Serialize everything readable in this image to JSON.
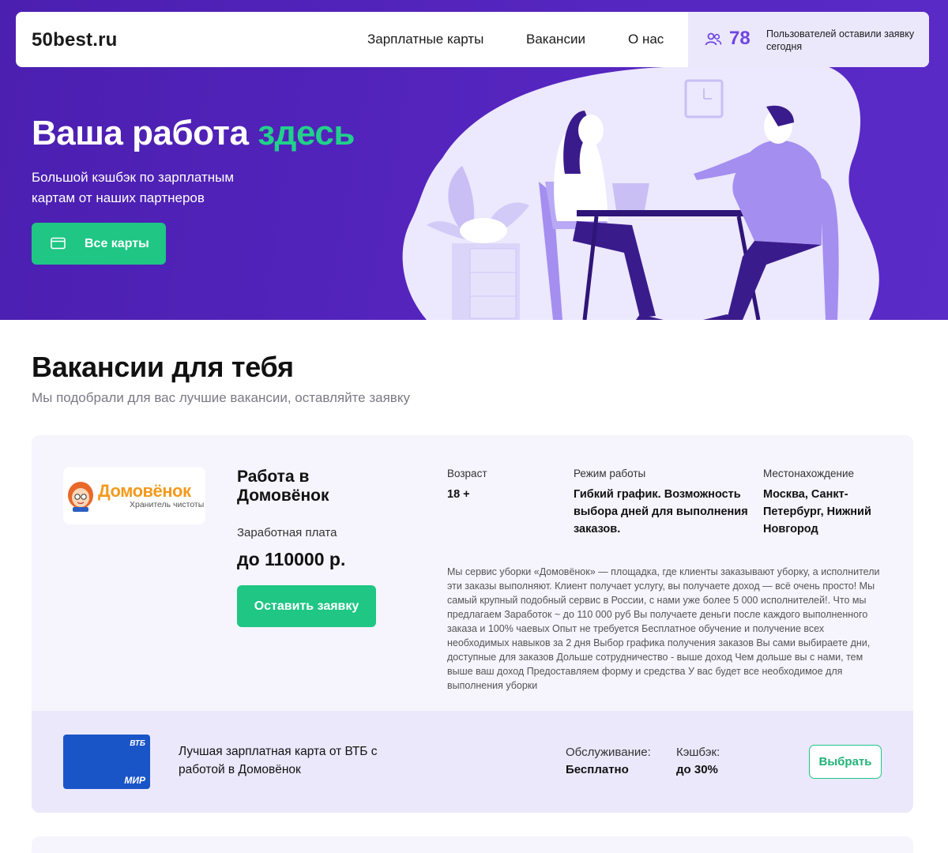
{
  "header": {
    "logo": "50best.ru",
    "nav": [
      "Зарплатные карты",
      "Вакансии",
      "О нас"
    ],
    "counter": {
      "icon": "users-icon",
      "value": "78",
      "text": "Пользователей оставили заявку сегодня"
    }
  },
  "hero": {
    "title_main": "Ваша работа",
    "title_accent": "здесь",
    "subtitle": "Большой кэшбэк по зарплатным картам от наших партнеров",
    "button_label": "Все карты",
    "button_icon": "card-icon",
    "colors": {
      "background": "#5424bd",
      "accent": "#21d18b",
      "button": "#1fc684"
    }
  },
  "section": {
    "title": "Вакансии для тебя",
    "subtitle": "Мы подобрали для вас лучшие вакансии, оставляйте заявку"
  },
  "vacancy": {
    "logo_name": "Домовёнок",
    "logo_tagline": "Хранитель чистоты",
    "title": "Работа в Домовёнок",
    "salary_label": "Заработная плата",
    "salary_value": "до 110000 р.",
    "apply_label": "Оставить заявку",
    "age_label": "Возраст",
    "age_value": "18 +",
    "schedule_label": "Режим работы",
    "schedule_value": "Гибкий график. Возможность выбора дней для выполнения заказов.",
    "location_label": "Местонахождение",
    "location_value": "Москва, Санкт-Петербург, Нижний Новгород",
    "description": "Мы сервис уборки «Домовёнок» — площадка, где клиенты заказывают уборку, а исполнители эти заказы выполняют. Клиент получает услугу, вы получаете доход — всё очень просто! Мы самый крупный подобный сервис в России, с нами уже более 5 000 исполнителей!. Что мы предлагаем Заработок ~ до 110 000 руб Вы получаете деньги после каждого выполненного заказа и 100% чаевых Опыт не требуется Бесплатное обучение и получение всех необходимых навыков за 2 дня Выбор графика получения заказов Вы сами выбираете дни, доступные для заказов Дольше сотрудничество - выше доход Чем дольше вы с нами, тем выше ваш доход Предоставляем форму и средства У вас будет все необходимое для выполнения уборки",
    "card_offer": {
      "bank": "ВТБ",
      "payment_system": "МИР",
      "title": "Лучшая зарплатная карта от ВТБ с работой в Домовёнок",
      "service_label": "Обслуживание:",
      "service_value": "Бесплатно",
      "cashback_label": "Кэшбэк:",
      "cashback_value": "до 30%",
      "choose_label": "Выбрать"
    }
  }
}
